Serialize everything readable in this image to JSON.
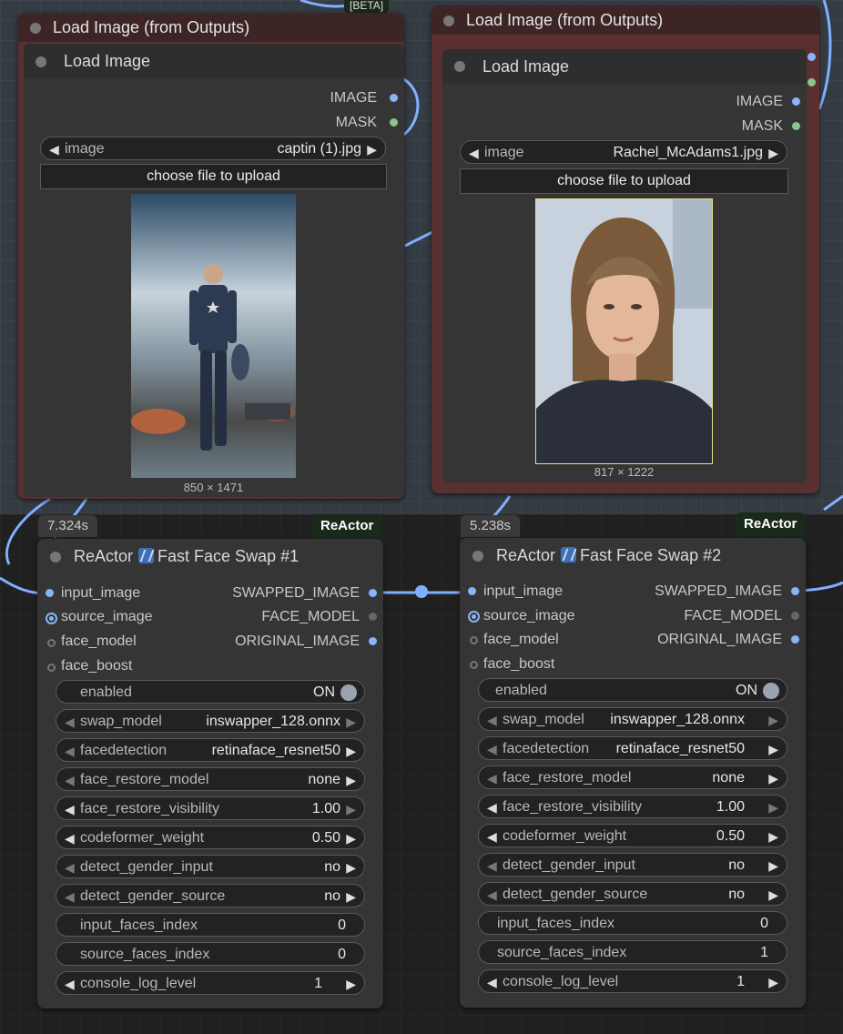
{
  "top_badge": "[BETA]",
  "load_nodes": [
    {
      "outer_title": "Load Image (from Outputs)",
      "inner_title": "Load Image",
      "outputs": [
        "IMAGE",
        "MASK"
      ],
      "image_widget": {
        "label": "image",
        "value": "captin (1).jpg"
      },
      "upload_button": "choose file to upload",
      "dims": "850 × 1471"
    },
    {
      "outer_title": "Load Image (from Outputs)",
      "inner_title": "Load Image",
      "outputs": [
        "IMAGE",
        "MASK"
      ],
      "image_widget": {
        "label": "image",
        "value": "Rachel_McAdams1.jpg"
      },
      "upload_button": "choose file to upload",
      "dims": "817 × 1222"
    }
  ],
  "reactor_nodes": [
    {
      "time": "7.324s",
      "badge": "ReActor",
      "title": "ReActor",
      "title_suffix": "Fast Face Swap #1",
      "inputs": [
        "input_image",
        "source_image",
        "face_model",
        "face_boost"
      ],
      "outputs": [
        "SWAPPED_IMAGE",
        "FACE_MODEL",
        "ORIGINAL_IMAGE"
      ],
      "widgets": [
        {
          "label": "enabled",
          "value": "ON"
        },
        {
          "label": "swap_model",
          "value": "inswapper_128.onnx"
        },
        {
          "label": "facedetection",
          "value": "retinaface_resnet50"
        },
        {
          "label": "face_restore_model",
          "value": "none"
        },
        {
          "label": "face_restore_visibility",
          "value": "1.00"
        },
        {
          "label": "codeformer_weight",
          "value": "0.50"
        },
        {
          "label": "detect_gender_input",
          "value": "no"
        },
        {
          "label": "detect_gender_source",
          "value": "no"
        },
        {
          "label": "input_faces_index",
          "value": "0"
        },
        {
          "label": "source_faces_index",
          "value": "0"
        },
        {
          "label": "console_log_level",
          "value": "1"
        }
      ]
    },
    {
      "time": "5.238s",
      "badge": "ReActor",
      "title": "ReActor",
      "title_suffix": "Fast Face Swap #2",
      "inputs": [
        "input_image",
        "source_image",
        "face_model",
        "face_boost"
      ],
      "outputs": [
        "SWAPPED_IMAGE",
        "FACE_MODEL",
        "ORIGINAL_IMAGE"
      ],
      "widgets": [
        {
          "label": "enabled",
          "value": "ON"
        },
        {
          "label": "swap_model",
          "value": "inswapper_128.onnx"
        },
        {
          "label": "facedetection",
          "value": "retinaface_resnet50"
        },
        {
          "label": "face_restore_model",
          "value": "none"
        },
        {
          "label": "face_restore_visibility",
          "value": "1.00"
        },
        {
          "label": "codeformer_weight",
          "value": "0.50"
        },
        {
          "label": "detect_gender_input",
          "value": "no"
        },
        {
          "label": "detect_gender_source",
          "value": "no"
        },
        {
          "label": "input_faces_index",
          "value": "0"
        },
        {
          "label": "source_faces_index",
          "value": "1"
        },
        {
          "label": "console_log_level",
          "value": "1"
        }
      ]
    }
  ],
  "colors": {
    "link": "#7fb0ff",
    "image_slot": "#8ab4f8",
    "mask_slot": "#8bc48b",
    "node_bg": "#353535"
  }
}
